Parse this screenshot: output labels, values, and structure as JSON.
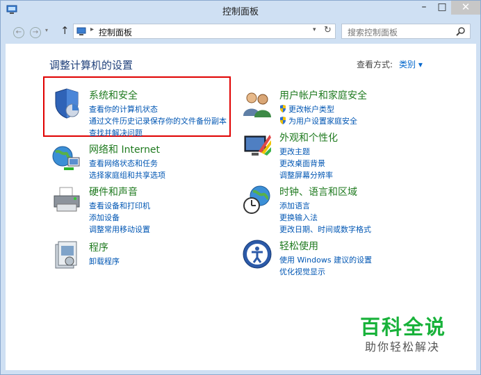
{
  "window": {
    "title": "控制面板"
  },
  "titlebar": {
    "minimize": "–",
    "maximize": "□",
    "close": "✕"
  },
  "address": {
    "path": "控制面板",
    "search_placeholder": "搜索控制面板"
  },
  "page": {
    "heading": "调整计算机的设置",
    "view_by_label": "查看方式:",
    "view_by_value": "类别 ▾"
  },
  "categories": [
    {
      "title": "系统和安全",
      "links": [
        "查看你的计算机状态",
        "通过文件历史记录保存你的文件备份副本",
        "查找并解决问题"
      ]
    },
    {
      "title": "网络和 Internet",
      "links": [
        "查看网络状态和任务",
        "选择家庭组和共享选项"
      ]
    },
    {
      "title": "硬件和声音",
      "links": [
        "查看设备和打印机",
        "添加设备",
        "调整常用移动设置"
      ]
    },
    {
      "title": "程序",
      "links": [
        "卸载程序"
      ]
    },
    {
      "title": "用户帐户和家庭安全",
      "links": [
        "更改帐户类型",
        "为用户设置家庭安全"
      ]
    },
    {
      "title": "外观和个性化",
      "links": [
        "更改主题",
        "更改桌面背景",
        "调整屏幕分辨率"
      ]
    },
    {
      "title": "时钟、语言和区域",
      "links": [
        "添加语言",
        "更换输入法",
        "更改日期、时间或数字格式"
      ]
    },
    {
      "title": "轻松使用",
      "links": [
        "使用 Windows 建议的设置",
        "优化视觉显示"
      ]
    }
  ],
  "watermark": {
    "brand": "百科全说",
    "tagline": "助你轻松解决"
  },
  "colors": {
    "link": "#0056b3",
    "category_title": "#1f7a1f",
    "highlight_box": "#e00000",
    "watermark": "#18b23a"
  }
}
